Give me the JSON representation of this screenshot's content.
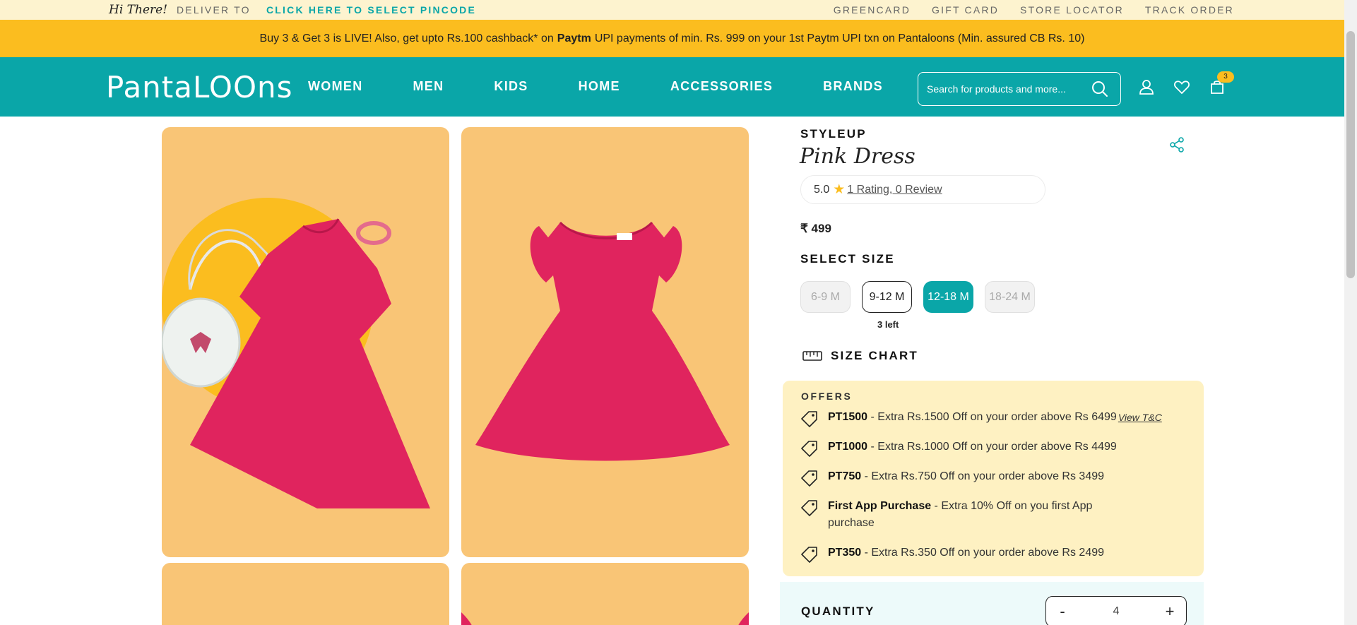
{
  "topbar": {
    "greeting": "Hi There!",
    "deliver_label": "DELIVER TO",
    "pincode_link": "CLICK HERE TO SELECT PINCODE",
    "links": [
      "GREENCARD",
      "GIFT CARD",
      "STORE LOCATOR",
      "TRACK ORDER"
    ]
  },
  "promo": {
    "text_before": "Buy 3 & Get 3 is LIVE! Also, get upto Rs.100 cashback* on",
    "bold": "Paytm",
    "text_after": "UPI payments of min. Rs. 999 on your 1st Paytm UPI txn on Pantaloons (Min. assured CB Rs. 10)"
  },
  "header": {
    "logo": "PantaLOOns",
    "nav": [
      "WOMEN",
      "MEN",
      "KIDS",
      "HOME",
      "ACCESSORIES",
      "BRANDS"
    ],
    "search_placeholder": "Search for products and more...",
    "cart_count": "3",
    "icons": [
      "search-icon",
      "user-icon",
      "heart-icon",
      "cart-icon"
    ]
  },
  "product": {
    "brand": "STYLEUP",
    "title": "Pink Dress",
    "rating_value": "5.0",
    "rating_link": "1 Rating, 0 Review",
    "price": "₹ 499",
    "select_size_label": "SELECT SIZE",
    "sizes": [
      {
        "label": "6-9 M",
        "state": "disabled"
      },
      {
        "label": "9-12 M",
        "state": "available"
      },
      {
        "label": "12-18 M",
        "state": "selected"
      },
      {
        "label": "18-24 M",
        "state": "disabled"
      }
    ],
    "stock_note": "3 left",
    "size_chart_label": "SIZE CHART"
  },
  "offers": {
    "heading": "OFFERS",
    "items": [
      {
        "code": "PT1500",
        "text": " - Extra Rs.1500 Off on your order above Rs 6499",
        "link": "View T&C"
      },
      {
        "code": "PT1000",
        "text": " - Extra Rs.1000 Off on your order above Rs 4499"
      },
      {
        "code": "PT750",
        "text": " - Extra Rs.750 Off on your order above Rs 3499"
      },
      {
        "code": "First App Purchase",
        "text": " - Extra 10% Off on you first App purchase"
      },
      {
        "code": "PT350",
        "text": " - Extra Rs.350 Off on your order above Rs 2499"
      }
    ]
  },
  "quantity": {
    "label": "QUANTITY",
    "minus": "-",
    "value": "4",
    "plus": "+"
  },
  "colors": {
    "teal": "#0aa6a8",
    "yellow": "#fbbd1f",
    "cream": "#fdf3cf",
    "offer_bg": "#fef1c2",
    "image_bg": "#f9c576",
    "dress_pink": "#e0245e"
  }
}
